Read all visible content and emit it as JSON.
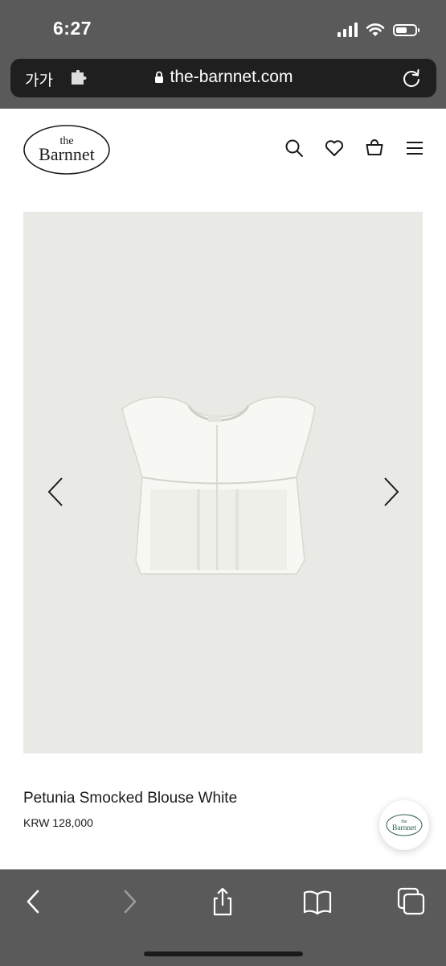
{
  "status_bar": {
    "time": "6:27",
    "battery_level": 0.6
  },
  "browser": {
    "text_size_label": "가가",
    "url": "the-barnnet.com"
  },
  "site": {
    "logo_text_small": "the",
    "logo_text_large": "Barnnet",
    "header_icons": [
      "search-icon",
      "heart-icon",
      "bag-icon",
      "menu-icon"
    ]
  },
  "product": {
    "name": "Petunia Smocked Blouse White",
    "price": "KRW 128,000",
    "image_background": "#e9e9e5"
  },
  "badge": {
    "logo_text_small": "the",
    "logo_text_large": "Barnnet",
    "logo_color": "#2f5e4a"
  },
  "toolbar": {
    "icons": [
      "back-icon",
      "forward-icon",
      "share-icon",
      "bookmarks-icon",
      "tabs-icon"
    ]
  }
}
